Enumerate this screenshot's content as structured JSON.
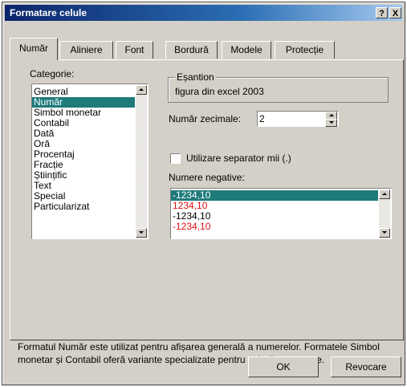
{
  "window": {
    "title": "Formatare celule",
    "help_label": "?",
    "close_label": "X"
  },
  "tabs": [
    {
      "label": "Număr",
      "active": true
    },
    {
      "label": "Aliniere",
      "active": false
    },
    {
      "label": "Font",
      "active": false
    },
    {
      "label": "Bordură",
      "active": false
    },
    {
      "label": "Modele",
      "active": false
    },
    {
      "label": "Protecție",
      "active": false
    }
  ],
  "category": {
    "label": "Categorie:",
    "items": [
      "General",
      "Număr",
      "Simbol monetar",
      "Contabil",
      "Dată",
      "Oră",
      "Procentaj",
      "Fracție",
      "Științific",
      "Text",
      "Special",
      "Particularizat"
    ],
    "selected": "Număr"
  },
  "sample": {
    "label": "Eșantion",
    "value": "figura din excel 2003"
  },
  "decimals": {
    "label": "Număr zecimale:",
    "value": "2"
  },
  "separator": {
    "label": "Utilizare separator mii (.)",
    "checked": false
  },
  "negatives": {
    "label": "Numere negative:",
    "items": [
      {
        "text": "-1234,10",
        "color": "#ffffff",
        "selected": true
      },
      {
        "text": "1234,10",
        "color": "#e01010",
        "selected": false
      },
      {
        "text": "-1234,10",
        "color": "#000000",
        "selected": false
      },
      {
        "text": "-1234,10",
        "color": "#e01010",
        "selected": false
      }
    ]
  },
  "description": "Formatul Număr este utilizat pentru afișarea generală a numerelor. Formatele Simbol monetar și Contabil oferă variante specializate pentru valorile monetare.",
  "buttons": {
    "ok": "OK",
    "cancel": "Revocare"
  },
  "colors": {
    "title_start": "#0a246a",
    "selection": "#1f7a7a",
    "negative_red": "#e01010",
    "face": "#d4d0c8"
  }
}
